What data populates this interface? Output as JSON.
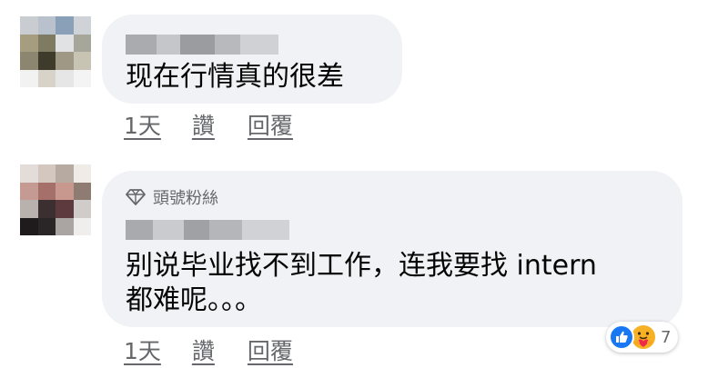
{
  "comments": [
    {
      "text": "现在行情真的很差",
      "actions": {
        "time": "1天",
        "like": "讚",
        "reply": "回覆"
      }
    },
    {
      "badge": "頭號粉絲",
      "text_line1": "别说毕业找不到工作，连我要找 intern",
      "text_line2": "都难呢。。。",
      "actions": {
        "time": "1天",
        "like": "讚",
        "reply": "回覆"
      },
      "reactions": {
        "icons": [
          "like-icon",
          "care-icon"
        ],
        "count": "7"
      }
    }
  ],
  "colors": {
    "bubble": "#f0f2f5",
    "meta_text": "#65676b",
    "like_blue": "#1877f2",
    "care_yellow": "#f7b125"
  }
}
